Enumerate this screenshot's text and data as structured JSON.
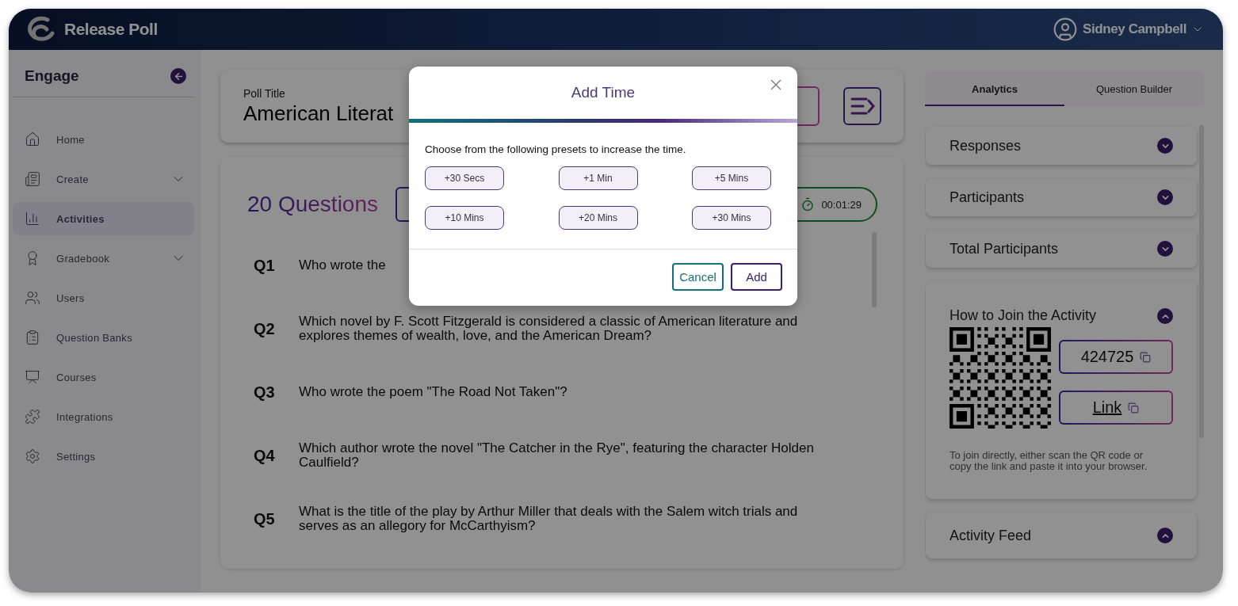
{
  "header": {
    "app_name": "Release Poll",
    "user_name": "Sidney Campbell"
  },
  "sidebar": {
    "title": "Engage",
    "items": [
      {
        "label": "Home",
        "selected": false,
        "has_submenu": false
      },
      {
        "label": "Create",
        "selected": false,
        "has_submenu": true
      },
      {
        "label": "Activities",
        "selected": true,
        "has_submenu": false
      },
      {
        "label": "Gradebook",
        "selected": false,
        "has_submenu": true
      },
      {
        "label": "Users",
        "selected": false,
        "has_submenu": false
      },
      {
        "label": "Question Banks",
        "selected": false,
        "has_submenu": false
      },
      {
        "label": "Courses",
        "selected": false,
        "has_submenu": false
      },
      {
        "label": "Integrations",
        "selected": false,
        "has_submenu": false
      },
      {
        "label": "Settings",
        "selected": false,
        "has_submenu": false
      }
    ]
  },
  "poll": {
    "label": "Poll Title",
    "title": "American Literat"
  },
  "questions": {
    "count_label": "20 Questions",
    "timer": "00:01:29",
    "items": [
      {
        "number": "Q1",
        "text": "Who wrote the"
      },
      {
        "number": "Q2",
        "text": "Which novel by F. Scott Fitzgerald is considered a classic of American literature and explores themes of wealth, love, and the American Dream?"
      },
      {
        "number": "Q3",
        "text": "Who wrote the poem \"The Road Not Taken\"?"
      },
      {
        "number": "Q4",
        "text": "Which author wrote the novel \"The Catcher in the Rye\", featuring the character Holden Caulfield?"
      },
      {
        "number": "Q5",
        "text": "What is the title of the play by Arthur Miller that deals with the Salem witch trials and serves as an allegory for McCarthyism?"
      }
    ]
  },
  "right_panel": {
    "tabs": [
      {
        "label": "Analytics",
        "selected": true
      },
      {
        "label": "Question Builder",
        "selected": false
      }
    ],
    "sections": [
      {
        "title": "Responses",
        "expanded": false
      },
      {
        "title": "Participants",
        "expanded": false
      },
      {
        "title": "Total Participants",
        "expanded": false
      },
      {
        "title": "How to Join the Activity",
        "expanded": true,
        "join_code": "424725",
        "link_label": "Link",
        "help_text": "To join directly, either scan the QR code or copy the link and paste it into your browser."
      },
      {
        "title": "Activity Feed",
        "expanded": true
      }
    ]
  },
  "modal": {
    "title": "Add Time",
    "instruction": "Choose from the following presets to increase the time.",
    "presets": [
      "+30 Secs",
      "+1 Min",
      "+5 Mins",
      "+10 Mins",
      "+20 Mins",
      "+30 Mins"
    ],
    "buttons": [
      {
        "label": "Cancel",
        "kind": "secondary"
      },
      {
        "label": "Add",
        "kind": "primary"
      }
    ]
  }
}
